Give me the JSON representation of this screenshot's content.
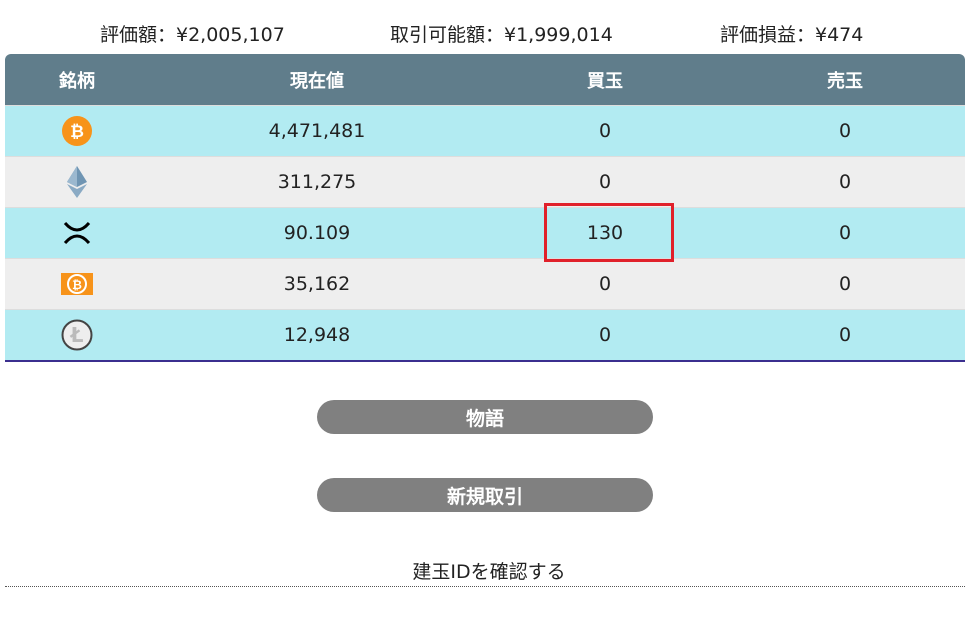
{
  "summary": {
    "valuation": "評価額：¥2,005,107",
    "tradable": "取引可能額：¥1,999,014",
    "pnl": "評価損益：¥474"
  },
  "table": {
    "headers": [
      "銘柄",
      "現在値",
      "買玉",
      "売玉"
    ],
    "rows": [
      {
        "icon": "bitcoin-icon",
        "price": "4,471,481",
        "buy": "0",
        "sell": "0"
      },
      {
        "icon": "ethereum-icon",
        "price": "311,275",
        "buy": "0",
        "sell": "0"
      },
      {
        "icon": "xrp-icon",
        "price": "90.109",
        "buy": "130",
        "sell": "0"
      },
      {
        "icon": "bitcoin-cash-icon",
        "price": "35,162",
        "buy": "0",
        "sell": "0"
      },
      {
        "icon": "litecoin-icon",
        "price": "12,948",
        "buy": "0",
        "sell": "0"
      }
    ],
    "highlighted_cell": {
      "row": 2,
      "column": "買玉"
    }
  },
  "buttons": {
    "story": "物語",
    "new_trade": "新規取引"
  },
  "link": "建玉IDを確認する",
  "colors": {
    "header": "#607d8b",
    "row_alt1": "#b2ebf2",
    "row_alt2": "#eeeeee",
    "button": "#808080",
    "highlight": "#e0202a"
  }
}
